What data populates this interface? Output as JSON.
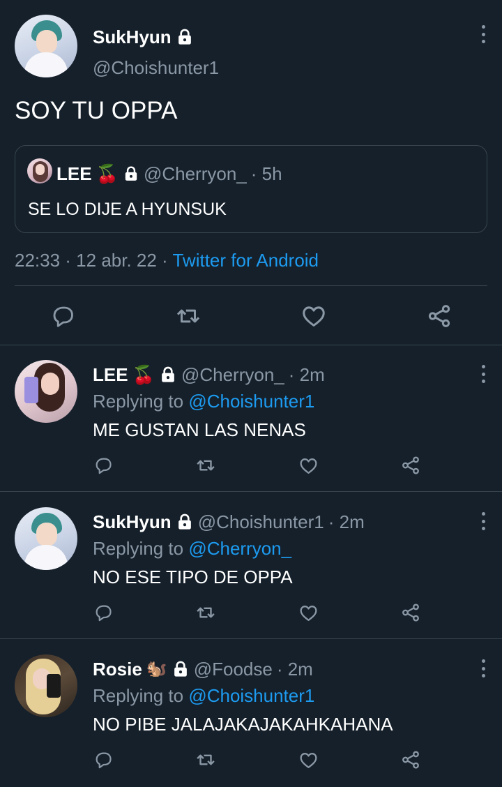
{
  "main_tweet": {
    "author_name": "SukHyun",
    "handle": "@Choishunter1",
    "text": "SOY TU OPPA",
    "quoted": {
      "author_name": "LEE",
      "emoji": "🍒",
      "handle": "@Cherryon_",
      "time": "· 5h",
      "text": "SE LO DIJE A HYUNSUK"
    },
    "timestamp": "22:33 · 12 abr. 22 ·",
    "source": "Twitter for Android"
  },
  "replies": [
    {
      "author_name": "LEE",
      "emoji": "🍒",
      "handle": "@Cherryon_",
      "time": "· 2m",
      "replying_prefix": "Replying to",
      "replying_to": "@Choishunter1",
      "text": "ME GUSTAN LAS NENAS"
    },
    {
      "author_name": "SukHyun",
      "emoji": "",
      "handle": "@Choishunter1",
      "time": "· 2m",
      "replying_prefix": "Replying to",
      "replying_to": "@Cherryon_",
      "text": "NO ESE TIPO DE OPPA"
    },
    {
      "author_name": "Rosie",
      "emoji": "🐿️",
      "handle": "@Foodse",
      "time": "· 2m",
      "replying_prefix": "Replying to",
      "replying_to": "@Choishunter1",
      "text": "NO PIBE JALAJAKAJAKAHKAHANA"
    }
  ],
  "icons": [
    "lock-icon",
    "more-icon",
    "reply-icon",
    "retweet-icon",
    "like-icon",
    "share-icon"
  ],
  "colors": {
    "background": "#15202b",
    "text": "#ffffff",
    "muted": "#8b98a5",
    "link": "#1d9bf0",
    "border": "#38444d"
  }
}
